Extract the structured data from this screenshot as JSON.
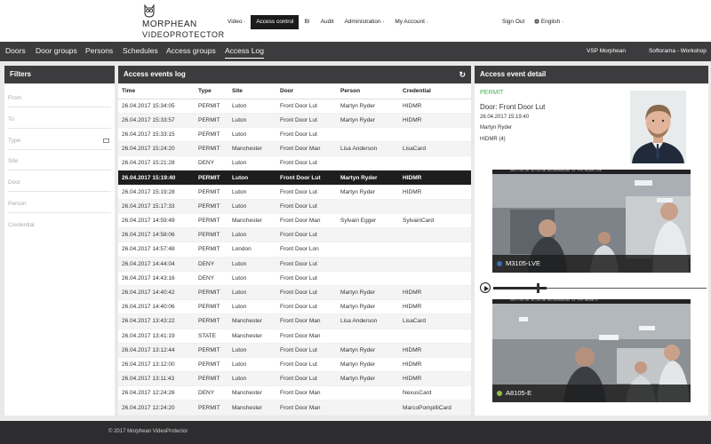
{
  "brand": {
    "line1": "MORPHEAN",
    "line2": "VIDEOPROTECTOR"
  },
  "topnav": {
    "items": [
      {
        "label": "Video",
        "caret": "›"
      },
      {
        "label": "Access control",
        "caret": ""
      },
      {
        "label": "BI",
        "caret": ""
      },
      {
        "label": "Audit",
        "caret": ""
      },
      {
        "label": "Administration",
        "caret": "›"
      },
      {
        "label": "My Account",
        "caret": "›"
      }
    ],
    "active_index": 1,
    "signout": "Sign Out",
    "language": "English",
    "language_caret": "›"
  },
  "subnav": {
    "items": [
      "Doors",
      "Door groups",
      "Persons",
      "Schedules",
      "Access groups",
      "Access Log"
    ],
    "active_index": 5,
    "site": "VSP Morphean",
    "workspace": "Softorama - Workshop"
  },
  "filters": {
    "title": "Filters",
    "fields": [
      "From",
      "To",
      "Type",
      "Site",
      "Door",
      "Person",
      "Credential"
    ]
  },
  "log": {
    "title": "Access events log",
    "columns": [
      "Time",
      "Type",
      "Site",
      "Door",
      "Person",
      "Credential"
    ],
    "selected_row": 5,
    "rows": [
      [
        "26.04.2017 15:34:05",
        "PERMIT",
        "Luton",
        "Front Door Lut",
        "Martyn Ryder",
        "HIDMR"
      ],
      [
        "26.04.2017 15:33:57",
        "PERMIT",
        "Luton",
        "Front Door Lut",
        "Martyn Ryder",
        "HIDMR"
      ],
      [
        "26.04.2017 15:33:15",
        "PERMIT",
        "Luton",
        "Front Door Lut",
        "",
        ""
      ],
      [
        "26.04.2017 15:24:20",
        "PERMIT",
        "Manchester",
        "Front Door Man",
        "Lisa Anderson",
        "LisaCard"
      ],
      [
        "26.04.2017 15:21:28",
        "DENY",
        "Luton",
        "Front Door Lut",
        "",
        ""
      ],
      [
        "26.04.2017 15:19:40",
        "PERMIT",
        "Luton",
        "Front Door Lut",
        "Martyn Ryder",
        "HIDMR"
      ],
      [
        "26.04.2017 15:19:28",
        "PERMIT",
        "Luton",
        "Front Door Lut",
        "Martyn Ryder",
        "HIDMR"
      ],
      [
        "26.04.2017 15:17:33",
        "PERMIT",
        "Luton",
        "Front Door Lut",
        "",
        ""
      ],
      [
        "26.04.2017 14:59:49",
        "PERMIT",
        "Manchester",
        "Front Door Man",
        "Sylvain Egger",
        "SylvainCard"
      ],
      [
        "26.04.2017 14:58:06",
        "PERMIT",
        "Luton",
        "Front Door Lut",
        "",
        ""
      ],
      [
        "26.04.2017 14:57:48",
        "PERMIT",
        "London",
        "Front Door Lon",
        "",
        ""
      ],
      [
        "26.04.2017 14:44:04",
        "DENY",
        "Luton",
        "Front Door Lut",
        "",
        ""
      ],
      [
        "26.04.2017 14:43:16",
        "DENY",
        "Luton",
        "Front Door Lut",
        "",
        ""
      ],
      [
        "26.04.2017 14:40:42",
        "PERMIT",
        "Luton",
        "Front Door Lut",
        "Martyn Ryder",
        "HIDMR"
      ],
      [
        "26.04.2017 14:40:06",
        "PERMIT",
        "Luton",
        "Front Door Lut",
        "Martyn Ryder",
        "HIDMR"
      ],
      [
        "26.04.2017 13:43:22",
        "PERMIT",
        "Manchester",
        "Front Door Man",
        "Lisa Anderson",
        "LisaCard"
      ],
      [
        "26.04.2017 13:41:19",
        "STATE",
        "Manchester",
        "Front Door Man",
        "",
        ""
      ],
      [
        "26.04.2017 13:12:44",
        "PERMIT",
        "Luton",
        "Front Door Lut",
        "Martyn Ryder",
        "HIDMR"
      ],
      [
        "26.04.2017 13:12:00",
        "PERMIT",
        "Luton",
        "Front Door Lut",
        "Martyn Ryder",
        "HIDMR"
      ],
      [
        "26.04.2017 13:11:43",
        "PERMIT",
        "Luton",
        "Front Door Lut",
        "Martyn Ryder",
        "HIDMR"
      ],
      [
        "26.04.2017 12:24:26",
        "DENY",
        "Manchester",
        "Front Door Man",
        "",
        "NexusCard"
      ],
      [
        "26.04.2017 12:24:20",
        "PERMIT",
        "Manchester",
        "Front Door Man",
        "",
        "MarcoPompilliCard"
      ]
    ]
  },
  "detail": {
    "title": "Access event detail",
    "status": "PERMIT",
    "door": "Door: Front Door Lut",
    "time": "26.04.2017 15:19:40",
    "person": "Martyn Ryder",
    "credential": "HIDMR (4)",
    "cameras": [
      {
        "name": "M3105-LVE",
        "overlay": "2017-04-26 15:19:36 ACC1050U1194   12 FPS   M3105-LVE",
        "dot_color": "#3f6fb5"
      },
      {
        "name": "A8105-E",
        "overlay": "2017-04-26 15:19:38 ACC1050U1194   12 FPS   A8105-E",
        "dot_color": "#8bc34a"
      }
    ],
    "playback_progress": 0.2
  },
  "colors": {
    "permit": "#4caf50",
    "header_dark": "#3c3c3e",
    "selected_row": "#1e1e1e"
  },
  "footer": {
    "text": "© 2017 Morphean VideoProtector"
  }
}
